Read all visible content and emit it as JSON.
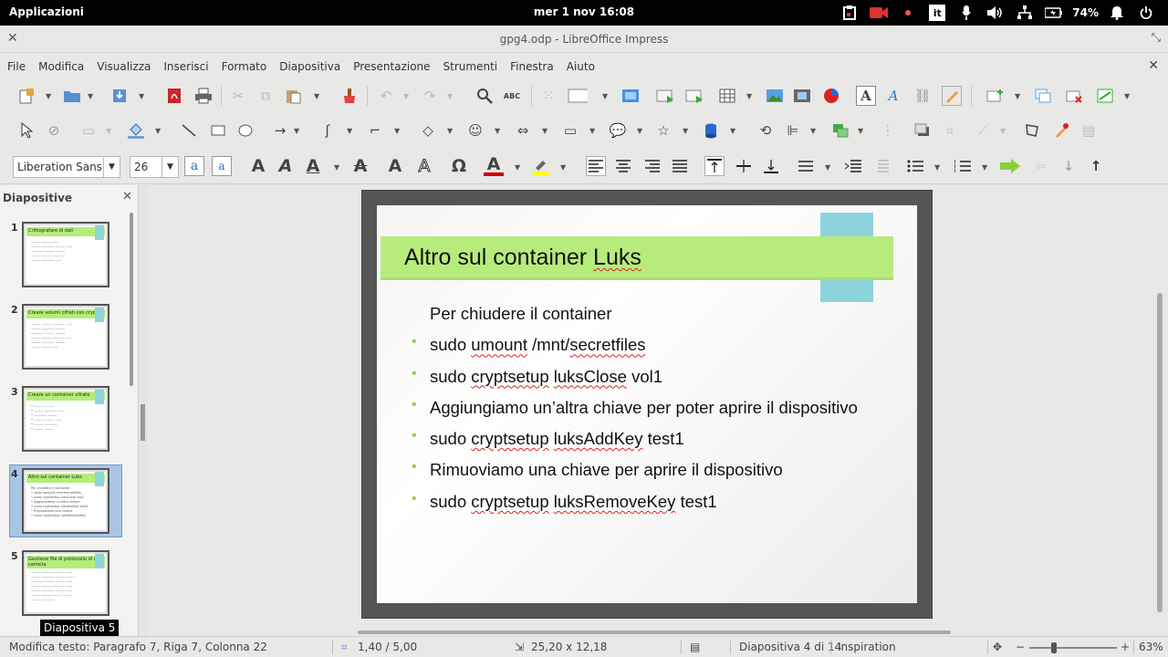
{
  "topbar": {
    "activities": "Applicazioni",
    "clock": "mer  1 nov   16:08",
    "battery": "74%",
    "keyboard_indicator": "it",
    "icons": [
      "clipboard-icon",
      "camera-icon",
      "notification-dot-icon",
      "keyboard-layout-icon",
      "microphone-icon",
      "volume-icon",
      "network-icon",
      "battery-icon",
      "bell-icon",
      "power-icon"
    ]
  },
  "window": {
    "title": "gpg4.odp - LibreOffice Impress"
  },
  "menubar": {
    "items": [
      "File",
      "Modifica",
      "Visualizza",
      "Inserisci",
      "Formato",
      "Diapositiva",
      "Presentazione",
      "Strumenti",
      "Finestra",
      "Aiuto"
    ]
  },
  "formatting": {
    "font_name": "Liberation Sans",
    "font_size": "26"
  },
  "slide_pane": {
    "header": "Diapositive",
    "tooltip": "Diapositiva 5",
    "thumbnails": [
      {
        "num": "1",
        "title": "Crittografare di dati"
      },
      {
        "num": "2",
        "title": "Creare volumi cifrati con cryptsetup"
      },
      {
        "num": "3",
        "title": "Creare un container cifrato"
      },
      {
        "num": "4",
        "title": "Altro sul container Luks"
      },
      {
        "num": "5",
        "title": "Gestione file di protocollo di una camicia"
      }
    ]
  },
  "slide": {
    "title_pre": "Altro sul container ",
    "title_err": "Luks",
    "intro": "Per chiudere il container",
    "bullets": [
      {
        "parts": [
          [
            "sudo ",
            false
          ],
          [
            "umount",
            true
          ],
          [
            " /mnt/",
            false
          ],
          [
            "secretfiles",
            true
          ]
        ]
      },
      {
        "parts": [
          [
            "sudo ",
            false
          ],
          [
            "cryptsetup",
            true
          ],
          [
            " ",
            false
          ],
          [
            "luksClose",
            true
          ],
          [
            " vol1",
            false
          ]
        ]
      },
      {
        "parts": [
          [
            "Aggiungiamo un’altra chiave per poter aprire il dispositivo",
            false
          ]
        ]
      },
      {
        "parts": [
          [
            "sudo ",
            false
          ],
          [
            "cryptsetup",
            true
          ],
          [
            " ",
            false
          ],
          [
            "luksAddKey",
            true
          ],
          [
            " test1",
            false
          ]
        ]
      },
      {
        "parts": [
          [
            "Rimuoviamo una chiave per aprire il dispositivo",
            false
          ]
        ]
      },
      {
        "parts": [
          [
            "sudo ",
            false
          ],
          [
            "cryptsetup",
            true
          ],
          [
            " ",
            false
          ],
          [
            "luksRemoveKey",
            true
          ],
          [
            " test1",
            false
          ]
        ]
      }
    ]
  },
  "statusbar": {
    "mode": "Modifica testo: Paragrafo 7, Riga 7, Colonna 22",
    "position": "1,40 / 5,00",
    "size": "25,20 x 12,18",
    "slide": "Diapositiva 4 di 14",
    "master": "Inspiration",
    "zoom": "63%"
  },
  "colors": {
    "title_band": "#b7ec7c",
    "accent_tab": "#8dd3dc",
    "bullet": "#8ccf52"
  }
}
